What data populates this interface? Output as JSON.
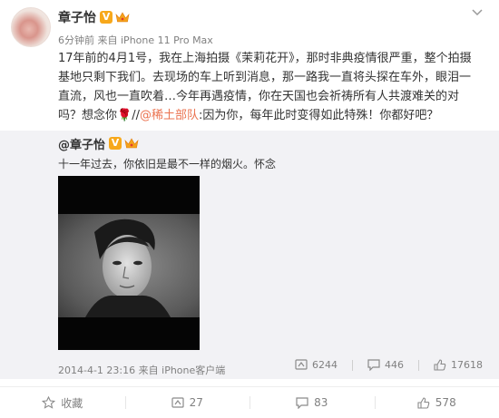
{
  "post": {
    "author": "章子怡",
    "verified_badge": "V",
    "time": "6分钟前",
    "source_prefix": "来自",
    "device": "iPhone 11 Pro Max",
    "text_part1": "17年前的4月1号，我在上海拍摄《茉莉花开》，那时非典疫情很严重，整个拍摄基地只剩下我们。去现场的车上听到消息，那一路我一直将头探在车外，眼泪一直流，风也一直吹着…今年再遇疫情，你在天国也会祈祷所有人共渡难关的对吗？想念你",
    "rose_emoji": "🌹",
    "text_sep": "//",
    "mention": "@稀土部队",
    "text_part2": ":因为你，每年此时变得如此特殊！你都好吧？"
  },
  "repost": {
    "author": "@章子怡",
    "verified_badge": "V",
    "text": "十一年过去，你依旧是最不一样的烟火。怀念",
    "date": "2014-4-1 23:16",
    "source_prefix": "来自",
    "device": "iPhone客户端",
    "reposts": "6244",
    "comments": "446",
    "likes": "17618"
  },
  "actions": {
    "favorite": "收藏",
    "repost": "27",
    "comment": "83",
    "like": "578"
  },
  "colors": {
    "mention": "#eb7350",
    "badge": "#f7a81b",
    "meta_gray": "#808080",
    "repost_bg": "#f2f2f5"
  },
  "icons": [
    "chevron-down-icon",
    "verified-icon",
    "crown-icon",
    "repost-icon",
    "comment-icon",
    "like-icon",
    "favorite-icon"
  ]
}
